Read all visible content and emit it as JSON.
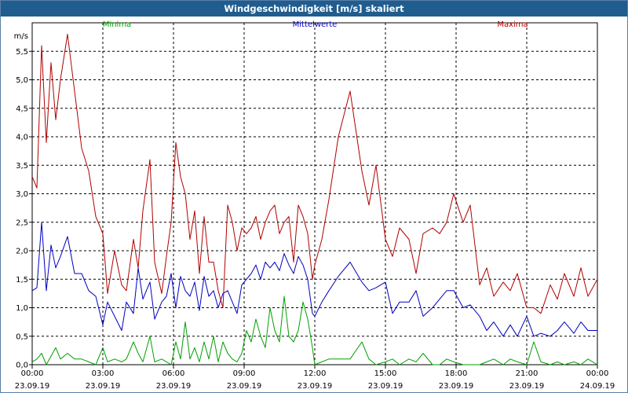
{
  "chart_data": {
    "type": "line",
    "title": "Windgeschwindigkeit [m/s] skaliert",
    "ylabel": "m/s",
    "ylim": [
      0,
      6
    ],
    "yticks": [
      "0,0",
      "0,5",
      "1,0",
      "1,5",
      "2,0",
      "2,5",
      "3,0",
      "3,5",
      "4,0",
      "4,5",
      "5,0",
      "5,5"
    ],
    "xrange_hours": [
      0,
      24
    ],
    "xticks": [
      {
        "time": "00:00",
        "date": "23.09.19"
      },
      {
        "time": "03:00",
        "date": "23.09.19"
      },
      {
        "time": "06:00",
        "date": "23.09.19"
      },
      {
        "time": "09:00",
        "date": "23.09.19"
      },
      {
        "time": "12:00",
        "date": "23.09.19"
      },
      {
        "time": "15:00",
        "date": "23.09.19"
      },
      {
        "time": "18:00",
        "date": "23.09.19"
      },
      {
        "time": "21:00",
        "date": "23.09.19"
      },
      {
        "time": "00:00",
        "date": "24.09.19"
      }
    ],
    "grid": true,
    "legend_position": "top",
    "series": [
      {
        "name": "Minima",
        "color": "#00a000",
        "x": [
          0,
          0.2,
          0.4,
          0.6,
          0.8,
          1,
          1.2,
          1.5,
          1.8,
          2.1,
          2.4,
          2.7,
          3,
          3.2,
          3.5,
          3.8,
          4,
          4.3,
          4.5,
          4.7,
          5,
          5.2,
          5.5,
          5.7,
          5.9,
          6.1,
          6.3,
          6.5,
          6.7,
          6.9,
          7.1,
          7.3,
          7.5,
          7.7,
          7.9,
          8.1,
          8.3,
          8.5,
          8.7,
          8.9,
          9.1,
          9.3,
          9.5,
          9.7,
          9.9,
          10.1,
          10.3,
          10.5,
          10.7,
          10.9,
          11.1,
          11.3,
          11.5,
          11.7,
          11.9,
          12,
          12.3,
          12.6,
          13,
          13.5,
          14,
          14.3,
          14.6,
          15,
          15.3,
          15.6,
          16,
          16.3,
          16.6,
          17,
          17.3,
          17.6,
          17.9,
          18.3,
          18.6,
          19,
          19.3,
          19.6,
          20,
          20.3,
          20.6,
          21,
          21.3,
          21.6,
          22,
          22.3,
          22.6,
          23,
          23.3,
          23.6,
          24
        ],
        "values": [
          0.05,
          0.1,
          0.2,
          0,
          0.15,
          0.3,
          0.1,
          0.2,
          0.1,
          0.1,
          0.05,
          0,
          0.3,
          0.05,
          0.1,
          0.05,
          0.1,
          0.4,
          0.2,
          0.05,
          0.5,
          0.05,
          0.1,
          0.05,
          0,
          0.4,
          0.1,
          0.75,
          0.1,
          0.3,
          0.05,
          0.4,
          0.1,
          0.5,
          0.05,
          0.4,
          0.2,
          0.1,
          0.05,
          0.2,
          0.6,
          0.4,
          0.8,
          0.5,
          0.3,
          1.0,
          0.6,
          0.4,
          1.2,
          0.5,
          0.4,
          0.6,
          1.1,
          0.8,
          0.3,
          0,
          0.05,
          0.1,
          0.1,
          0.1,
          0.4,
          0.1,
          0,
          0.05,
          0.1,
          0,
          0.1,
          0.05,
          0.2,
          0,
          0,
          0.1,
          0.05,
          0,
          0,
          0,
          0.05,
          0.1,
          0,
          0.1,
          0.05,
          0,
          0.4,
          0.05,
          0,
          0.05,
          0,
          0.05,
          0,
          0.1,
          0
        ],
        "end_hour": 24
      },
      {
        "name": "Mittelwerte",
        "color": "#0000c0",
        "x": [
          0,
          0.2,
          0.4,
          0.6,
          0.8,
          1,
          1.2,
          1.5,
          1.8,
          2.1,
          2.4,
          2.7,
          3,
          3.2,
          3.5,
          3.8,
          4,
          4.3,
          4.5,
          4.7,
          5,
          5.2,
          5.5,
          5.7,
          5.9,
          6.1,
          6.3,
          6.5,
          6.7,
          6.9,
          7.1,
          7.3,
          7.5,
          7.7,
          7.9,
          8.1,
          8.3,
          8.5,
          8.7,
          8.9,
          9.1,
          9.3,
          9.5,
          9.7,
          9.9,
          10.1,
          10.3,
          10.5,
          10.7,
          10.9,
          11.1,
          11.3,
          11.5,
          11.7,
          11.9,
          12,
          12.3,
          12.6,
          13,
          13.5,
          14,
          14.3,
          14.6,
          15,
          15.3,
          15.6,
          16,
          16.3,
          16.6,
          17,
          17.3,
          17.6,
          17.9,
          18.3,
          18.6,
          19,
          19.3,
          19.6,
          20,
          20.3,
          20.6,
          21,
          21.3,
          21.6,
          22,
          22.3,
          22.6,
          23,
          23.3,
          23.6,
          24
        ],
        "values": [
          1.3,
          1.35,
          2.5,
          1.3,
          2.1,
          1.7,
          1.9,
          2.25,
          1.6,
          1.6,
          1.3,
          1.2,
          0.7,
          1.1,
          0.85,
          0.6,
          1.1,
          0.9,
          1.7,
          1.15,
          1.45,
          0.8,
          1.1,
          1.2,
          1.6,
          1.0,
          1.55,
          1.3,
          1.2,
          1.45,
          0.95,
          1.55,
          1.2,
          1.3,
          1.0,
          1.25,
          1.3,
          1.1,
          0.9,
          1.4,
          1.5,
          1.6,
          1.75,
          1.5,
          1.8,
          1.7,
          1.8,
          1.65,
          1.95,
          1.75,
          1.6,
          1.9,
          1.75,
          1.5,
          0.9,
          0.85,
          1.1,
          1.3,
          1.55,
          1.8,
          1.45,
          1.3,
          1.35,
          1.45,
          0.9,
          1.1,
          1.1,
          1.3,
          0.85,
          1.0,
          1.15,
          1.3,
          1.3,
          1.0,
          1.05,
          0.85,
          0.6,
          0.75,
          0.5,
          0.7,
          0.5,
          0.85,
          0.5,
          0.55,
          0.5,
          0.6,
          0.75,
          0.55,
          0.75,
          0.6,
          0.6
        ],
        "end_hour": 24
      },
      {
        "name": "Maxima",
        "color": "#b00000",
        "x": [
          0,
          0.2,
          0.4,
          0.6,
          0.8,
          1,
          1.2,
          1.5,
          1.8,
          2.1,
          2.4,
          2.7,
          3,
          3.2,
          3.5,
          3.8,
          4,
          4.3,
          4.5,
          4.7,
          5,
          5.2,
          5.5,
          5.7,
          5.9,
          6.1,
          6.3,
          6.5,
          6.7,
          6.9,
          7.1,
          7.3,
          7.5,
          7.7,
          7.9,
          8.1,
          8.3,
          8.5,
          8.7,
          8.9,
          9.1,
          9.3,
          9.5,
          9.7,
          9.9,
          10.1,
          10.3,
          10.5,
          10.7,
          10.9,
          11.1,
          11.3,
          11.5,
          11.7,
          11.9,
          12,
          12.3,
          12.6,
          13,
          13.5,
          14,
          14.3,
          14.6,
          15,
          15.3,
          15.6,
          16,
          16.3,
          16.6,
          17,
          17.3,
          17.6,
          17.9,
          18.3,
          18.6,
          19,
          19.3,
          19.6,
          20,
          20.3,
          20.6,
          21,
          21.3,
          21.6,
          22,
          22.3,
          22.6,
          23,
          23.3,
          23.6,
          24
        ],
        "values": [
          3.3,
          3.1,
          5.6,
          3.9,
          5.3,
          4.3,
          5.0,
          5.8,
          4.8,
          3.8,
          3.4,
          2.6,
          2.3,
          1.25,
          2.0,
          1.4,
          1.3,
          2.2,
          1.7,
          2.7,
          3.6,
          1.8,
          1.25,
          1.9,
          2.5,
          3.9,
          3.3,
          3.0,
          2.2,
          2.7,
          1.6,
          2.6,
          1.8,
          1.8,
          1.3,
          1.0,
          2.8,
          2.5,
          2.0,
          2.4,
          2.3,
          2.4,
          2.6,
          2.2,
          2.5,
          2.7,
          2.8,
          2.3,
          2.5,
          2.6,
          1.8,
          2.8,
          2.6,
          2.3,
          1.5,
          1.75,
          2.2,
          2.9,
          4.0,
          4.8,
          3.4,
          2.8,
          3.5,
          2.2,
          1.9,
          2.4,
          2.2,
          1.6,
          2.3,
          2.4,
          2.3,
          2.5,
          3.0,
          2.5,
          2.8,
          1.4,
          1.7,
          1.2,
          1.45,
          1.3,
          1.6,
          1.0,
          1.0,
          0.9,
          1.4,
          1.15,
          1.6,
          1.2,
          1.7,
          1.2,
          1.5
        ],
        "end_hour": 24
      }
    ]
  }
}
